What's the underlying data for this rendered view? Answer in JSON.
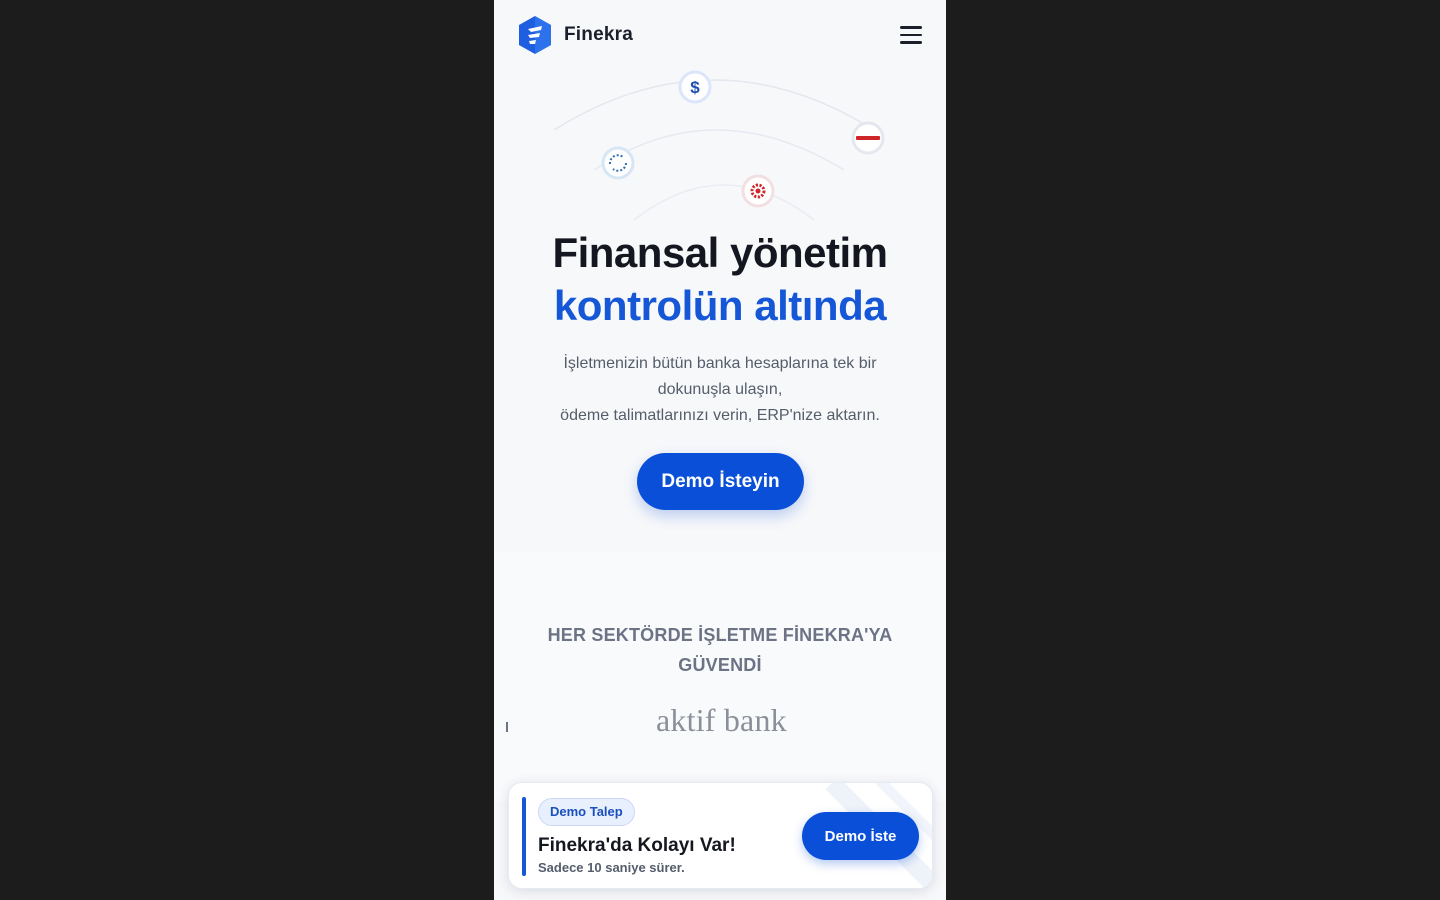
{
  "header": {
    "brand_name": "Finekra"
  },
  "hero": {
    "title_line1": "Finansal yönetim",
    "title_line2": "kontrolün altında",
    "subtitle_line1": "İşletmenizin bütün banka hesaplarına tek bir dokunuşla ulaşın,",
    "subtitle_line2": "ödeme talimatlarınızı verin, ERP'nize aktarın.",
    "cta_label": "Demo İsteyin"
  },
  "orbit_icons": [
    {
      "name": "dollar-icon",
      "glyph": "$"
    },
    {
      "name": "bank-logo-icon",
      "glyph": ""
    },
    {
      "name": "sync-icon",
      "glyph": ""
    },
    {
      "name": "gear-icon",
      "glyph": ""
    }
  ],
  "trust": {
    "title": "HER SEKTÖRDE İŞLETME FİNEKRA'YA GÜVENDİ",
    "partner_logo_text": "aktif bank"
  },
  "demo_bar": {
    "badge": "Demo Talep",
    "title": "Finekra'da Kolayı Var!",
    "subtitle": "Sadece 10 saniye sürer.",
    "button_label": "Demo İste"
  },
  "colors": {
    "primary": "#0a4fd8",
    "accent_text": "#1557d6",
    "dark_text": "#14171f",
    "background": "#1c1c1c"
  }
}
